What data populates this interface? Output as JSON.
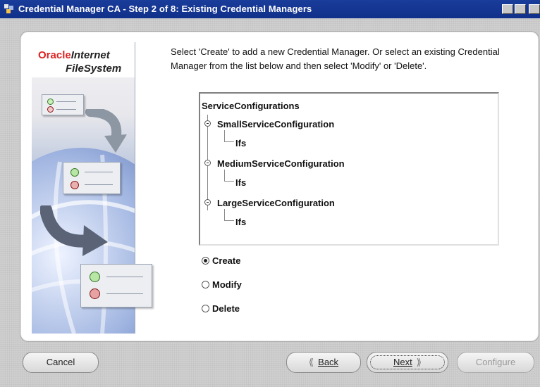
{
  "window": {
    "title": "Credential Manager CA - Step 2 of 8: Existing Credential Managers"
  },
  "brand": {
    "oracle": "Oracle",
    "internet": "Internet",
    "filesystem": "FileSystem"
  },
  "instructions": "Select 'Create' to add a new Credential Manager. Or select an existing Credential Manager from the list below and then select 'Modify' or 'Delete'.",
  "tree": {
    "root": "ServiceConfigurations",
    "items": [
      {
        "label": "SmallServiceConfiguration",
        "child": "Ifs"
      },
      {
        "label": "MediumServiceConfiguration",
        "child": "Ifs"
      },
      {
        "label": "LargeServiceConfiguration",
        "child": "Ifs"
      }
    ]
  },
  "options": {
    "selected": "Create",
    "items": [
      "Create",
      "Modify",
      "Delete"
    ]
  },
  "buttons": {
    "cancel": "Cancel",
    "back": "Back",
    "next": "Next",
    "configure": "Configure"
  },
  "colors": {
    "title_bar": "#10308a",
    "oracle_red": "#d22222"
  }
}
